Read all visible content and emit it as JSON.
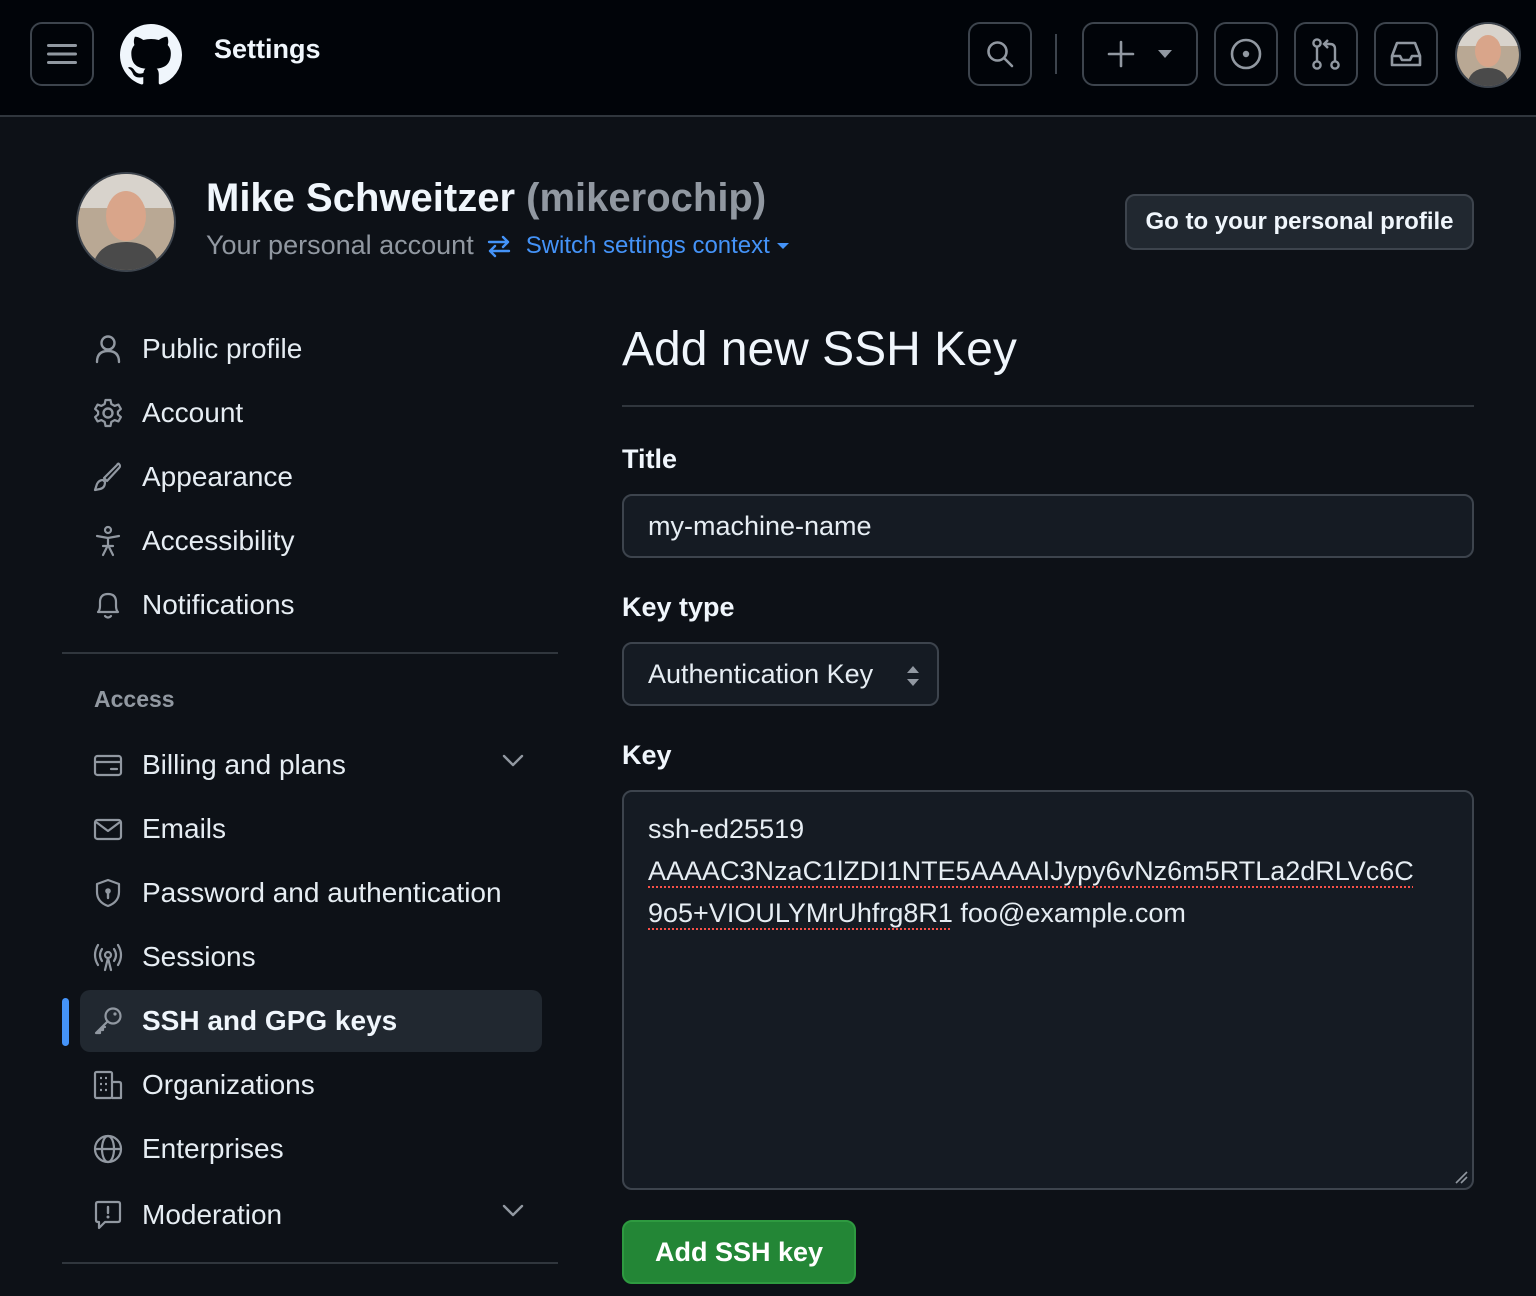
{
  "header": {
    "title": "Settings",
    "icons": [
      "menu-icon",
      "github-logo",
      "search-icon",
      "plus-icon",
      "triangle-down-icon",
      "issue-icon",
      "pull-request-icon",
      "inbox-icon"
    ]
  },
  "profile": {
    "name": "Mike Schweitzer",
    "handle": "(mikerochip)",
    "subtitle": "Your personal account",
    "switch_label": "Switch settings context",
    "go_profile_label": "Go to your personal profile"
  },
  "sidebar": {
    "items": [
      {
        "label": "Public profile",
        "icon": "person-icon"
      },
      {
        "label": "Account",
        "icon": "gear-icon"
      },
      {
        "label": "Appearance",
        "icon": "paintbrush-icon"
      },
      {
        "label": "Accessibility",
        "icon": "accessibility-icon"
      },
      {
        "label": "Notifications",
        "icon": "bell-icon"
      }
    ],
    "access_heading": "Access",
    "access_items": [
      {
        "label": "Billing and plans",
        "icon": "credit-card-icon",
        "expandable": true
      },
      {
        "label": "Emails",
        "icon": "mail-icon"
      },
      {
        "label": "Password and authentication",
        "icon": "shield-lock-icon"
      },
      {
        "label": "Sessions",
        "icon": "broadcast-icon"
      },
      {
        "label": "SSH and GPG keys",
        "icon": "key-icon",
        "active": true
      },
      {
        "label": "Organizations",
        "icon": "organization-icon"
      },
      {
        "label": "Enterprises",
        "icon": "globe-icon"
      },
      {
        "label": "Moderation",
        "icon": "report-icon",
        "expandable": true
      }
    ]
  },
  "form": {
    "page_title": "Add new SSH Key",
    "title_label": "Title",
    "title_value": "my-machine-name",
    "key_type_label": "Key type",
    "key_type_value": "Authentication Key",
    "key_label": "Key",
    "key_value_line1": "ssh-ed25519",
    "key_value_line2": "AAAAC3NzaC1lZDI1NTE5AAAAIJypy6vNz6m5RTLa2dRLVc6C",
    "key_value_line3a": "9o5+VIOULYMrUhfrg8R1",
    "key_value_line3b": " foo@example.com",
    "submit_label": "Add SSH key"
  },
  "colors": {
    "background": "#0d1117",
    "header_bg": "#010409",
    "accent_blue": "#4493f8",
    "submit_green": "#238636"
  }
}
